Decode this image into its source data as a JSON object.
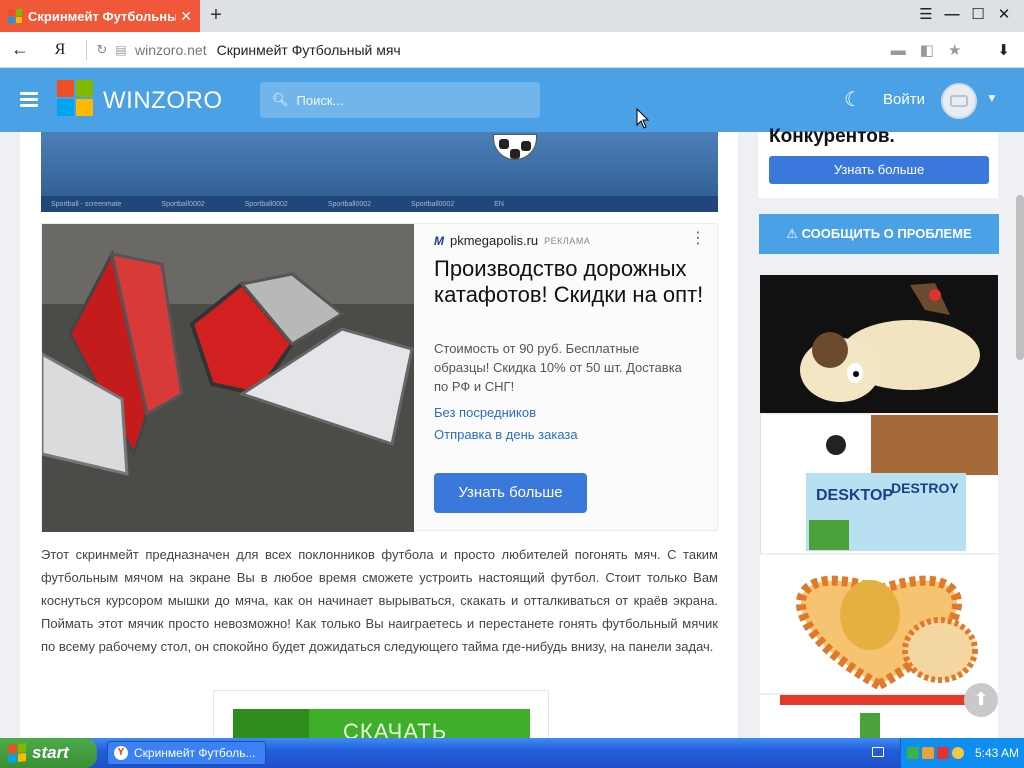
{
  "browser": {
    "tab_title": "Скринмейт Футбольный",
    "tab_close": "✕",
    "new_tab": "+",
    "url_host": "winzoro.net",
    "url_title": "Скринмейт Футбольный мяч",
    "yandex_button": "Я",
    "back_glyph": "←",
    "window_controls": [
      "☰",
      "—",
      "☐",
      "✕"
    ]
  },
  "site": {
    "logo_text": "WINZORO",
    "search_placeholder": "Поиск...",
    "login_label": "Войти",
    "brand_colors": [
      "#f04e23",
      "#7fba00",
      "#00a4ef",
      "#ffb900"
    ],
    "header_color": "#4aa1e6"
  },
  "hero": {
    "taskbar_items": [
      "Sportball - screenmate",
      "Sportball0002",
      "Sportball0002",
      "Sportball0002",
      "Sportball0002",
      "EN"
    ]
  },
  "ad": {
    "domain": "pkmegapolis.ru",
    "tag": "РЕКЛАМА",
    "title": "Производство дорожных катафотов! Скидки на опт!",
    "description": "Стоимость от 90 руб. Бесплатные образцы! Скидка 10% от 50 шт. Доставка по РФ и СНГ!",
    "link1": "Без посредников",
    "link2": "Отправка в день заказа",
    "button": "Узнать больше",
    "more_glyph": "⋮"
  },
  "article": {
    "text": "Этот скринмейт предназначен для всех поклонников футбола и просто любителей погонять мяч. С таким футбольным мячом на экране Вы в любое время сможете устроить настоящий футбол. Стоит только Вам коснуться курсором мышки до мяча, как он начинает вырываться, скакать и отталкиваться от краёв экрана. Поймать этот мячик просто невозможно! Как только Вы наиграетесь и перестанете гонять футбольный мячик по всему рабочему стол, он спокойно будет дожидаться следующего тайма где-нибудь внизу, на панели задач."
  },
  "download": {
    "label": "СКАЧАТЬ"
  },
  "sidebar": {
    "card_text": "Конкурентов.",
    "card_button": "Узнать больше",
    "report_button": "⚠ СООБЩИТЬ О ПРОБЛЕМЕ",
    "thumb2_text1": "DESKTOP",
    "thumb2_text2": "DESTROY",
    "scroll_top": "⬆"
  },
  "taskbar": {
    "start_label": "start",
    "task_label": "Скринмейт Футболь...",
    "clock": "5:43 AM"
  }
}
